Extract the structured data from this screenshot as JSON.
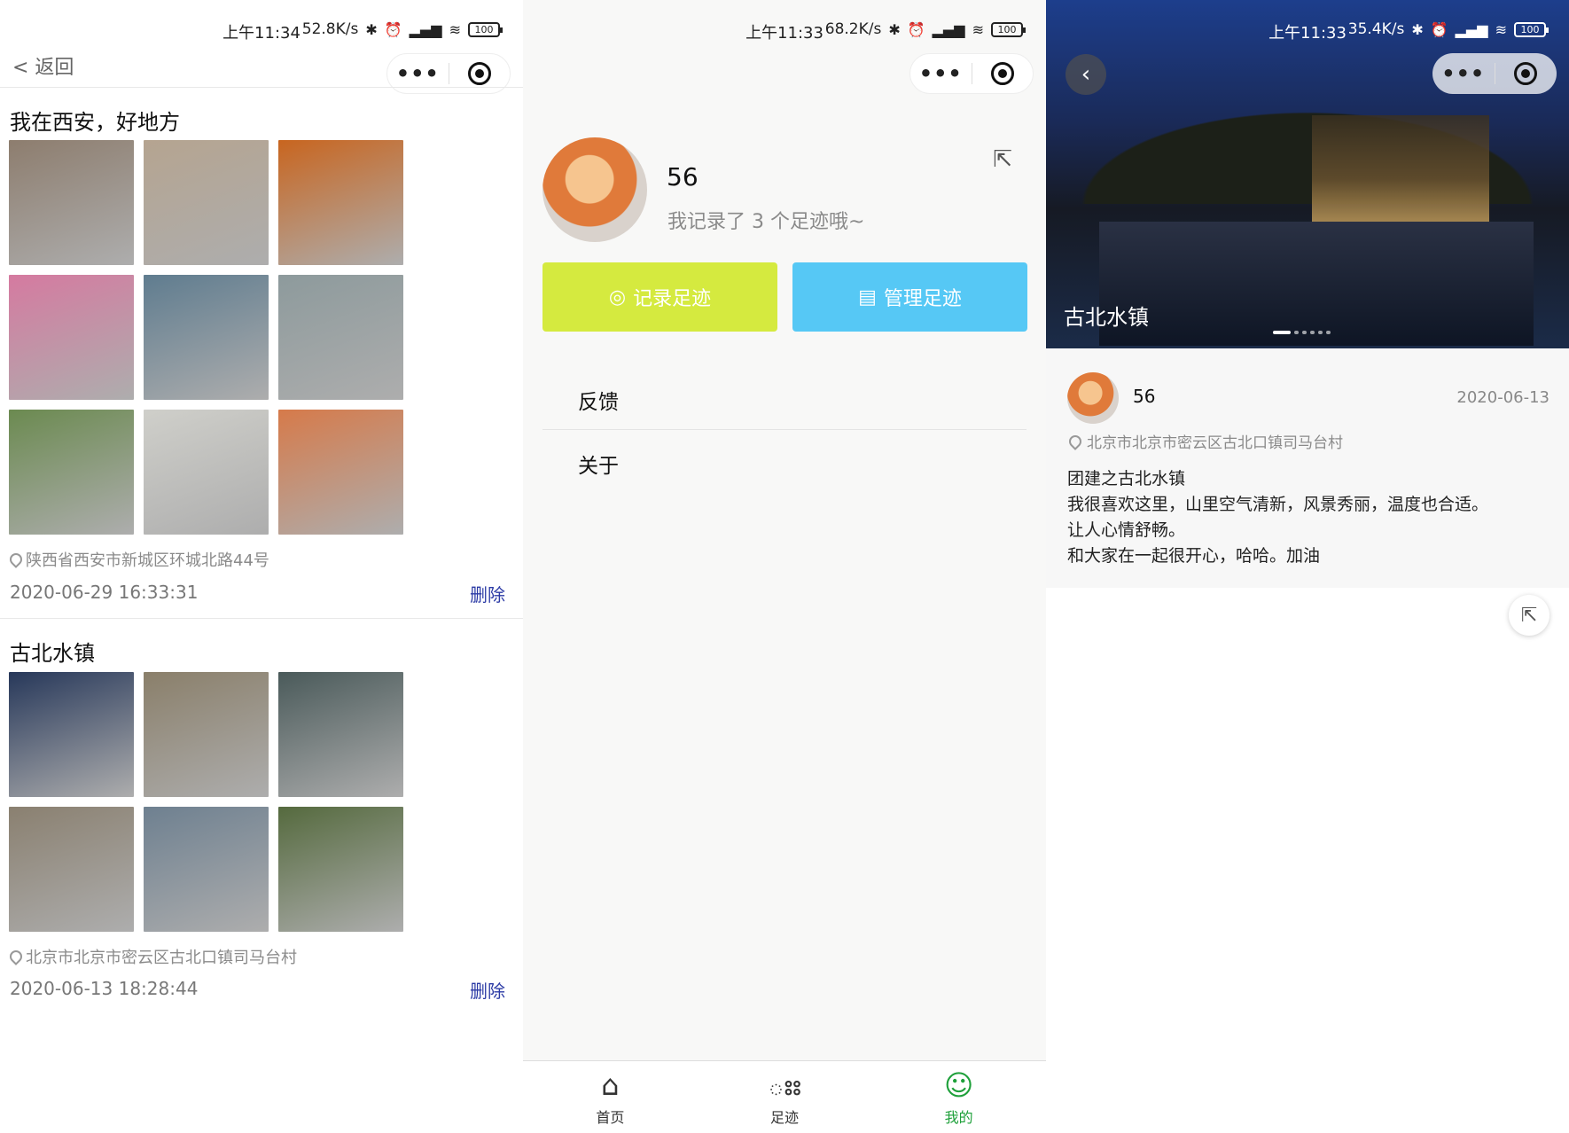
{
  "status_bars": [
    {
      "time": "上午11:34",
      "net": "52.8K/s",
      "battery": "100"
    },
    {
      "time": "上午11:33",
      "net": "68.2K/s",
      "battery": "100"
    },
    {
      "time": "上午11:33",
      "net": "35.4K/s",
      "battery": "100"
    }
  ],
  "capsule": {
    "more_icon": "more-dots-icon",
    "close_icon": "target-icon"
  },
  "list_screen": {
    "back_label": "< 返回",
    "posts": [
      {
        "title": "我在西安，好地方",
        "photo_colors": [
          "#8d7d6e",
          "#b5a490",
          "#c8651f",
          "#d57aa0",
          "#5f7c8f",
          "#8d9a9c",
          "#6b8a50",
          "#cfcfca",
          "#d67a4a"
        ],
        "location": "陕西省西安市新城区环城北路44号",
        "datetime": "2020-06-29 16:33:31",
        "delete_label": "删除"
      },
      {
        "title": "古北水镇",
        "photo_colors": [
          "#27385a",
          "#8a7f6a",
          "#4a5a5a",
          "#8a8070",
          "#6e8090",
          "#556a3e"
        ],
        "location": "北京市北京市密云区古北口镇司马台村",
        "datetime": "2020-06-13 18:28:44",
        "delete_label": "删除"
      }
    ]
  },
  "profile_screen": {
    "name": "56",
    "subtitle": "我记录了 3 个足迹哦~",
    "record_button": "记录足迹",
    "manage_button": "管理足迹",
    "menu": [
      "反馈",
      "关于"
    ],
    "tabs": [
      {
        "label": "首页",
        "icon": "home-icon"
      },
      {
        "label": "足迹",
        "icon": "paw-icon"
      },
      {
        "label": "我的",
        "icon": "user-icon"
      }
    ],
    "colors": {
      "record": "#d5ea3f",
      "manage": "#56c8f5",
      "active_tab": "#1ea03a"
    }
  },
  "detail_screen": {
    "banner_caption": "古北水镇",
    "carousel_count": 6,
    "author": "56",
    "date": "2020-06-13",
    "location": "北京市北京市密云区古北口镇司马台村",
    "text_lines": [
      "团建之古北水镇",
      "我很喜欢这里，山里空气清新，风景秀丽，温度也合适。",
      "让人心情舒畅。",
      "和大家在一起很开心，哈哈。加油"
    ]
  }
}
